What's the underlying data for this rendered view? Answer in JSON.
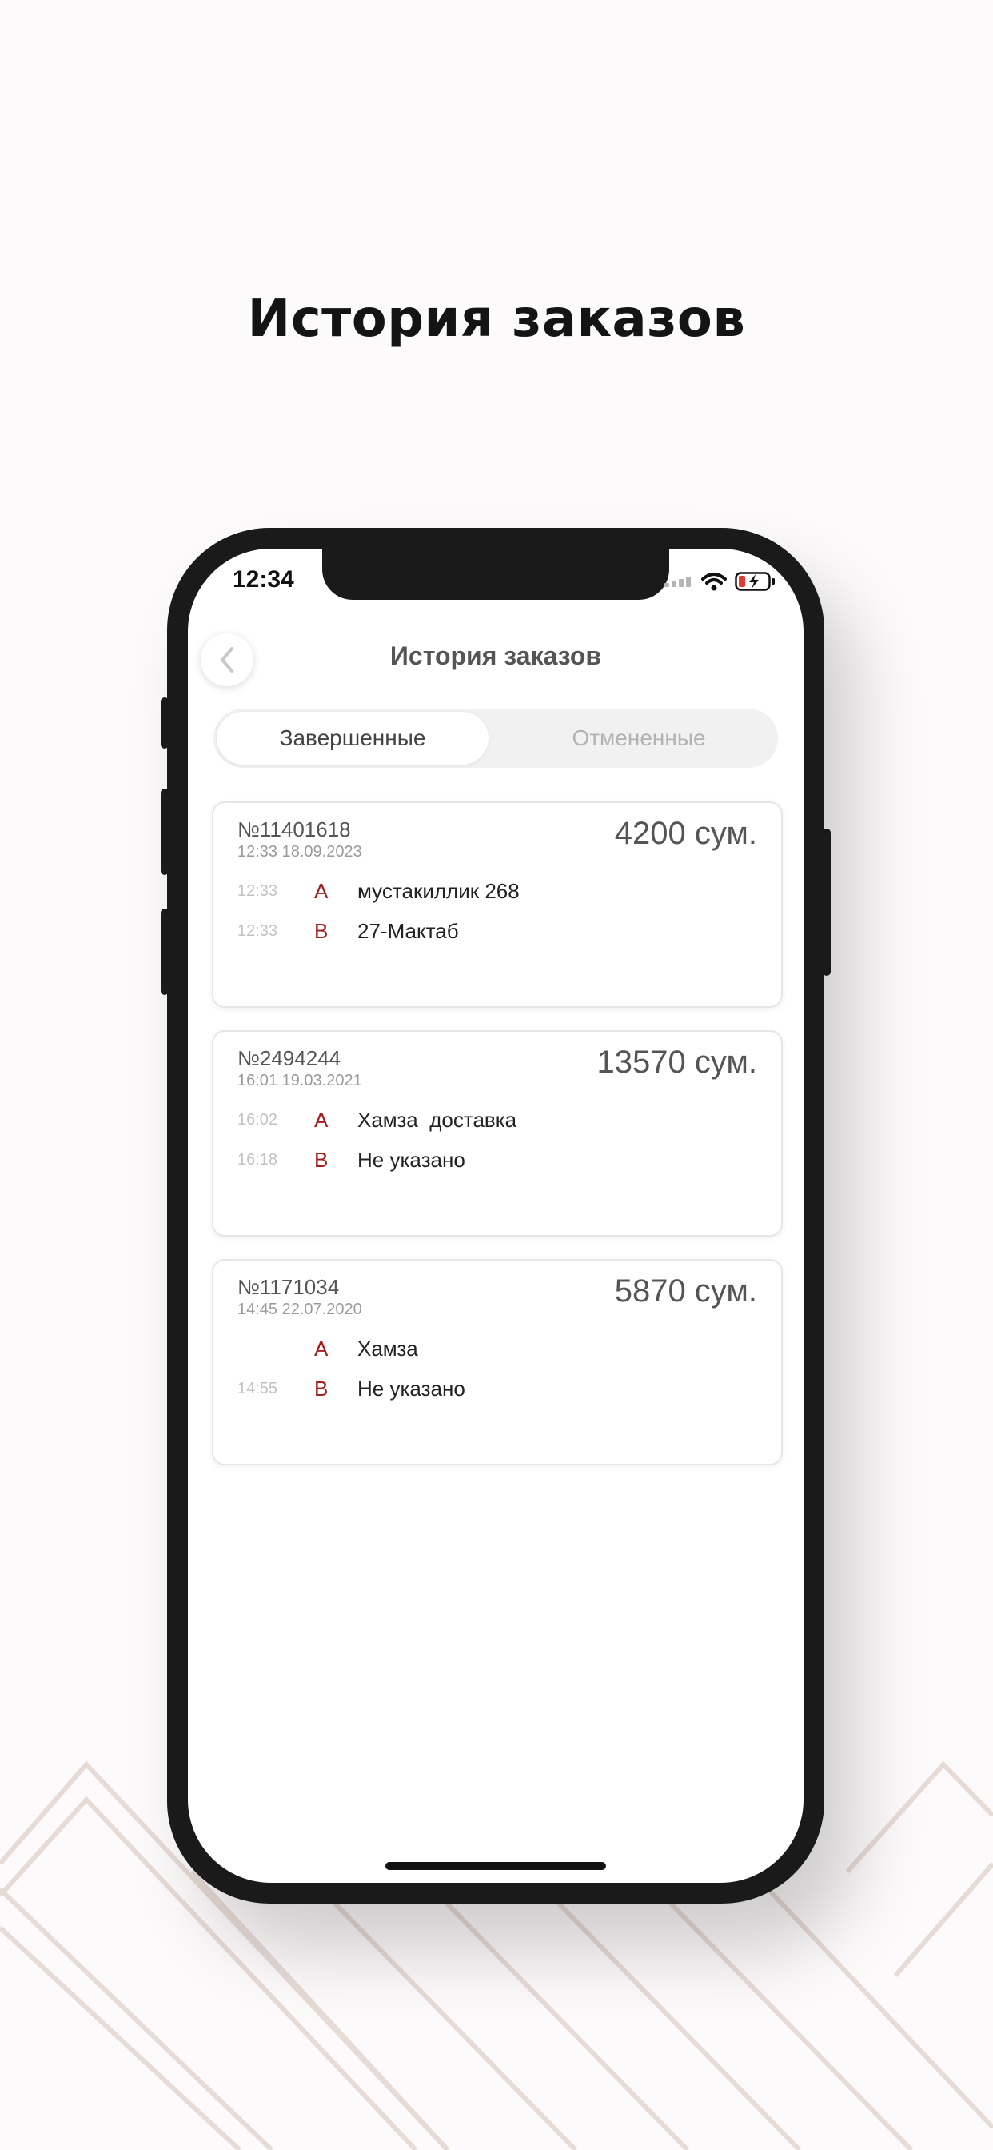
{
  "headline": "История заказов",
  "status_bar": {
    "time": "12:34",
    "icons": [
      "signal-icon",
      "wifi-icon",
      "battery-charging-icon"
    ]
  },
  "screen": {
    "title": "История заказов",
    "back_icon": "chevron-left-icon",
    "tabs": [
      {
        "label": "Завершенные",
        "active": true
      },
      {
        "label": "Отмененные",
        "active": false
      }
    ]
  },
  "orders": [
    {
      "number": "№11401618",
      "datetime": "12:33 18.09.2023",
      "sum": "4200 сум.",
      "points": [
        {
          "time": "12:33",
          "letter": "A",
          "address": "мустакиллик 268"
        },
        {
          "time": "12:33",
          "letter": "B",
          "address": "27-Мактаб"
        }
      ]
    },
    {
      "number": "№2494244",
      "datetime": "16:01 19.03.2021",
      "sum": "13570 сум.",
      "points": [
        {
          "time": "16:02",
          "letter": "A",
          "address": "Хамза  доставка"
        },
        {
          "time": "16:18",
          "letter": "B",
          "address": "Не указано"
        }
      ]
    },
    {
      "number": "№1171034",
      "datetime": "14:45 22.07.2020",
      "sum": "5870 сум.",
      "points": [
        {
          "time": "",
          "letter": "A",
          "address": "Хамза"
        },
        {
          "time": "14:55",
          "letter": "B",
          "address": "Не указано"
        }
      ]
    }
  ],
  "colors": {
    "accent_letter": "#a41c1c",
    "frame": "#1a1a1a",
    "background": "#fcfafa",
    "decor_line": "#e7dbd6"
  }
}
